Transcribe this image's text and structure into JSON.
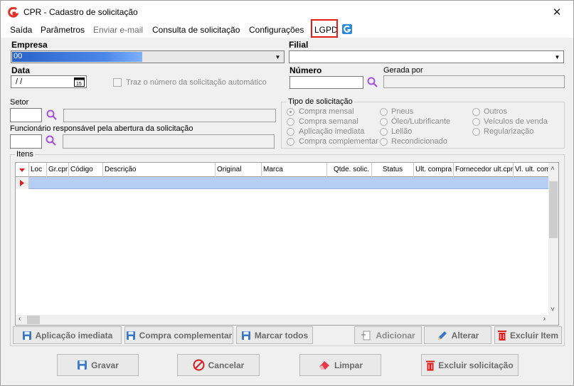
{
  "window": {
    "title": "CPR - Cadastro de solicitação",
    "close": "✕"
  },
  "menu": {
    "items": [
      {
        "label": "Saída",
        "disabled": false
      },
      {
        "label": "Parâmetros",
        "disabled": false
      },
      {
        "label": "Enviar e-mail",
        "disabled": true
      },
      {
        "label": "Consulta de solicitação",
        "disabled": false
      },
      {
        "label": "Configurações",
        "disabled": false
      },
      {
        "label": "LGPD",
        "disabled": false
      }
    ]
  },
  "form": {
    "empresa_label": "Empresa",
    "empresa_value": "00",
    "filial_label": "Filial",
    "filial_value": "",
    "data_label": "Data",
    "data_value": " /  /",
    "traz_numero_label": "Traz o número da solicitação automático",
    "numero_label": "Número",
    "numero_value": "",
    "gerada_por_label": "Gerada por",
    "setor_label": "Setor",
    "funcionario_label": "Funcionário responsável pela abertura da solicitação"
  },
  "tipo_solicitacao": {
    "title": "Tipo de solicitação",
    "options": [
      "Compra mensal",
      "Compra semanal",
      "Aplicação imediata",
      "Compra complementar",
      "Pneus",
      "Óleo/Lubrificante",
      "Leilão",
      "Recondicionado",
      "Outros",
      "Veículos de venda",
      "Regularização"
    ],
    "selected": "Compra mensal"
  },
  "itens": {
    "title": "Itens",
    "columns": [
      "Loc",
      "Gr.cpr",
      "Código",
      "Descrição",
      "Original",
      "Marca",
      "Qtde. solic.",
      "Status",
      "Ult. compra",
      "Fornecedor ult.cpr",
      "Vl. ult. com"
    ],
    "rows": []
  },
  "item_buttons": {
    "aplicacao": "Aplicação imediata",
    "complementar": "Compra complementar",
    "marcar": "Marcar todos",
    "adicionar": "Adicionar",
    "alterar": "Alterar",
    "excluir_item": "Excluir Item"
  },
  "bottom_buttons": {
    "gravar": "Gravar",
    "cancelar": "Cancelar",
    "limpar": "Limpar",
    "excluir_solicitacao": "Excluir solicitação"
  },
  "colors": {
    "accent": "#e21b1b",
    "selection": "#b7cdf2",
    "brand_blue": "#2a8ad4"
  }
}
